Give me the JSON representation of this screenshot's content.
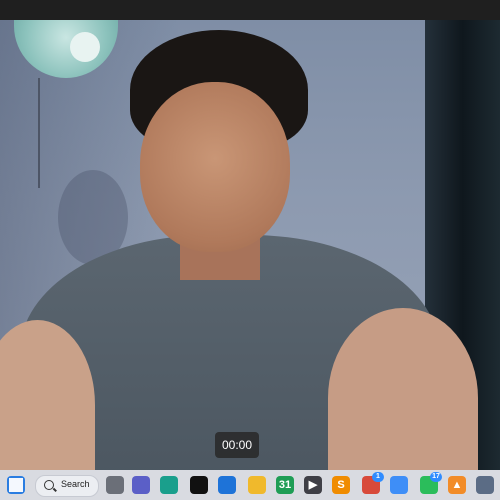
{
  "camera": {
    "timer": "00:00"
  },
  "taskbar": {
    "search_label": "Search",
    "apps": [
      {
        "name": "task-view",
        "color": "#6b6f78"
      },
      {
        "name": "teams-chat",
        "color": "#5b5fc7"
      },
      {
        "name": "edge",
        "color": "#1a9f8c"
      },
      {
        "name": "capcut",
        "color": "#111111"
      },
      {
        "name": "mail",
        "color": "#1e73d8"
      },
      {
        "name": "file-explorer",
        "color": "#f0b92c"
      },
      {
        "name": "calendar",
        "color": "#1f9d55",
        "label": "31"
      },
      {
        "name": "media-player",
        "color": "#3f3f46"
      },
      {
        "name": "sublime-text",
        "color": "#f08c00"
      },
      {
        "name": "chrome",
        "color": "#d84a3a",
        "badge": "1"
      },
      {
        "name": "chrome-2",
        "color": "#3e8ef7"
      },
      {
        "name": "whatsapp",
        "color": "#2bbd5b",
        "badge": "17"
      },
      {
        "name": "vlc",
        "color": "#f28c28"
      },
      {
        "name": "camera",
        "color": "#5b6c85"
      }
    ]
  }
}
